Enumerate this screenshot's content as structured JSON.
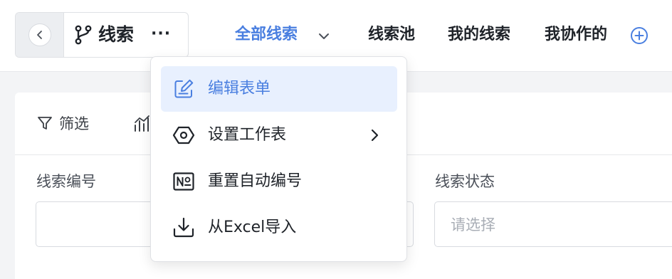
{
  "app": {
    "title": "线索",
    "more_label": "···"
  },
  "tabs": [
    {
      "label": "全部线索",
      "active": true
    },
    {
      "label": "线索池",
      "active": false
    },
    {
      "label": "我的线索",
      "active": false
    },
    {
      "label": "我协作的",
      "active": false
    }
  ],
  "toolbar": {
    "filter_label": "筛选"
  },
  "fields": [
    {
      "label": "线索编号",
      "value": ""
    },
    {
      "label": "线索状态",
      "placeholder": "请选择"
    }
  ],
  "menu": {
    "items": [
      {
        "label": "编辑表单",
        "icon": "edit-form-icon",
        "highlighted": true
      },
      {
        "label": "设置工作表",
        "icon": "settings-hexagon-icon",
        "has_submenu": true
      },
      {
        "label": "重置自动编号",
        "icon": "numero-icon"
      },
      {
        "label": "从Excel导入",
        "icon": "import-icon"
      }
    ]
  },
  "colors": {
    "accent": "#4a7fe0",
    "highlight_bg": "#e8f0fe"
  }
}
